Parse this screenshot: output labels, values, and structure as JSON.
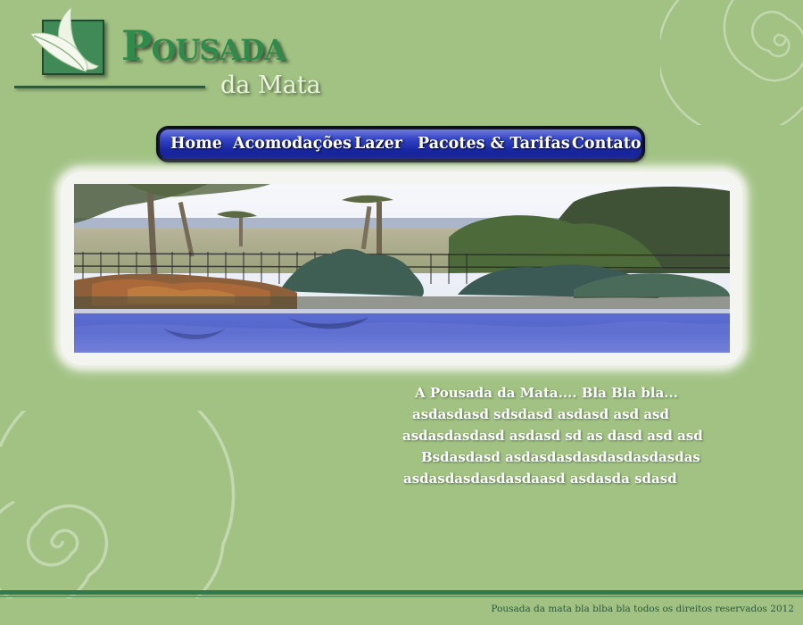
{
  "brand": {
    "title": "Pousada",
    "subtitle": "da Mata"
  },
  "nav": {
    "items": [
      {
        "label": "Home"
      },
      {
        "label": "Acomodações"
      },
      {
        "label": "Lazer"
      },
      {
        "label": "Pacotes & Tarifas"
      },
      {
        "label": "Contato"
      }
    ]
  },
  "intro": {
    "lines": [
      "A Pousada da Mata.... Bla Bla bla...",
      "asdasdasd sdsdasd asdasd asd asd",
      "asdasdasdasd asdasd sd as dasd asd asd",
      "Bsdasdasd asdasdasdasdasdasdasdas",
      "asdasdasdasdasdaasd asdasda sdasd"
    ]
  },
  "footer": {
    "text": "Pousada da mata bla blba bla todos os direitos reservados 2012"
  },
  "colors": {
    "background": "#a1c283",
    "brand_green": "#2f8a4b",
    "nav_blue": "#1a2aa6",
    "footer_green": "#2f7a50"
  },
  "icons": {
    "logo": "leaf-logo-icon",
    "decor": "spiral-swirl-icon"
  }
}
